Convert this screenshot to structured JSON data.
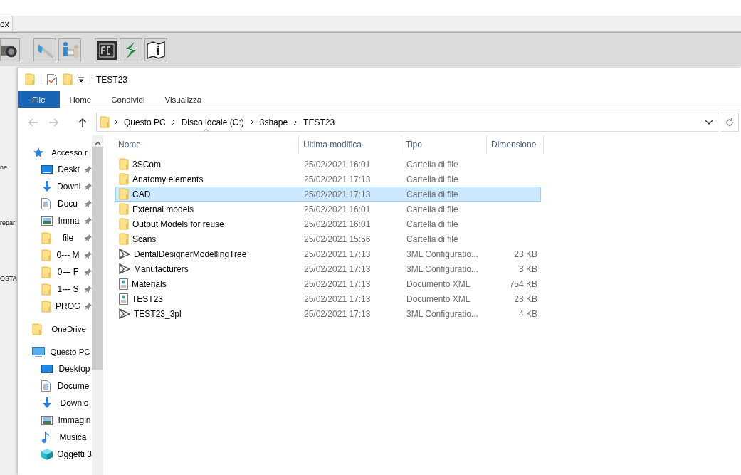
{
  "background_app": {
    "tab": "ox",
    "toolbar": [
      {
        "kind": "camera"
      },
      {
        "kind": "wand"
      },
      {
        "kind": "people"
      },
      {
        "kind": "fc"
      },
      {
        "kind": "logo"
      },
      {
        "kind": "manual"
      }
    ],
    "side_texts": [
      "ne",
      "repar",
      "OSTA"
    ]
  },
  "explorer": {
    "title": "TEST23",
    "ribbon_tabs": [
      {
        "label": "File",
        "selected": true
      },
      {
        "label": "Home",
        "selected": false
      },
      {
        "label": "Condividi",
        "selected": false
      },
      {
        "label": "Visualizza",
        "selected": false
      }
    ],
    "breadcrumb": [
      "Questo PC",
      "Disco locale (C:)",
      "3shape",
      "TEST23"
    ],
    "nav": [
      {
        "label": "Accesso r",
        "kind": "star",
        "children": [
          {
            "label": "Deskt",
            "kind": "desktop",
            "pinned": true
          },
          {
            "label": "Downl",
            "kind": "download",
            "pinned": true
          },
          {
            "label": "Docu",
            "kind": "document",
            "pinned": true
          },
          {
            "label": "Imma",
            "kind": "image",
            "pinned": true
          },
          {
            "label": "file",
            "kind": "folder",
            "pinned": true
          },
          {
            "label": "0--- M",
            "kind": "folder",
            "pinned": true
          },
          {
            "label": "0--- F",
            "kind": "folder",
            "pinned": true
          },
          {
            "label": "1--- S",
            "kind": "folder",
            "pinned": true
          },
          {
            "label": "PROG",
            "kind": "folder",
            "pinned": true
          }
        ]
      },
      {
        "label": "OneDrive",
        "kind": "folder"
      },
      {
        "label": "Questo PC",
        "kind": "pc",
        "children": [
          {
            "label": "Desktop",
            "kind": "desktop",
            "pinned": false
          },
          {
            "label": "Docume",
            "kind": "document",
            "pinned": false
          },
          {
            "label": "Downlo",
            "kind": "download",
            "pinned": false
          },
          {
            "label": "Immagin",
            "kind": "image",
            "pinned": false
          },
          {
            "label": "Musica",
            "kind": "music",
            "pinned": false
          },
          {
            "label": "Oggetti 3",
            "kind": "cube",
            "pinned": false
          }
        ]
      }
    ],
    "columns": [
      "Nome",
      "Ultima modifica",
      "Tipo",
      "Dimensione"
    ],
    "rows": [
      {
        "kind": "folder",
        "name": "3SCom",
        "modified": "25/02/2021 16:01",
        "type": "Cartella di file",
        "size": "",
        "selected": false
      },
      {
        "kind": "folder",
        "name": "Anatomy elements",
        "modified": "25/02/2021 17:13",
        "type": "Cartella di file",
        "size": "",
        "selected": false
      },
      {
        "kind": "folder",
        "name": "CAD",
        "modified": "25/02/2021 17:13",
        "type": "Cartella di file",
        "size": "",
        "selected": true
      },
      {
        "kind": "folder",
        "name": "External models",
        "modified": "25/02/2021 16:01",
        "type": "Cartella di file",
        "size": "",
        "selected": false
      },
      {
        "kind": "folder",
        "name": "Output Models for reuse",
        "modified": "25/02/2021 16:01",
        "type": "Cartella di file",
        "size": "",
        "selected": false
      },
      {
        "kind": "folder",
        "name": "Scans",
        "modified": "25/02/2021 15:56",
        "type": "Cartella di file",
        "size": "",
        "selected": false
      },
      {
        "kind": "model",
        "name": "DentalDesignerModellingTree",
        "modified": "25/02/2021 17:13",
        "type": "3ML Configuratio...",
        "size": "23 KB",
        "selected": false
      },
      {
        "kind": "model",
        "name": "Manufacturers",
        "modified": "25/02/2021 17:13",
        "type": "3ML Configuratio...",
        "size": "3 KB",
        "selected": false
      },
      {
        "kind": "xml",
        "name": "Materials",
        "modified": "25/02/2021 17:13",
        "type": "Documento XML",
        "size": "754 KB",
        "selected": false
      },
      {
        "kind": "xml",
        "name": "TEST23",
        "modified": "25/02/2021 17:13",
        "type": "Documento XML",
        "size": "23 KB",
        "selected": false
      },
      {
        "kind": "model",
        "name": "TEST23_3pl",
        "modified": "25/02/2021 17:13",
        "type": "3ML Configuratio...",
        "size": "4 KB",
        "selected": false
      }
    ]
  }
}
